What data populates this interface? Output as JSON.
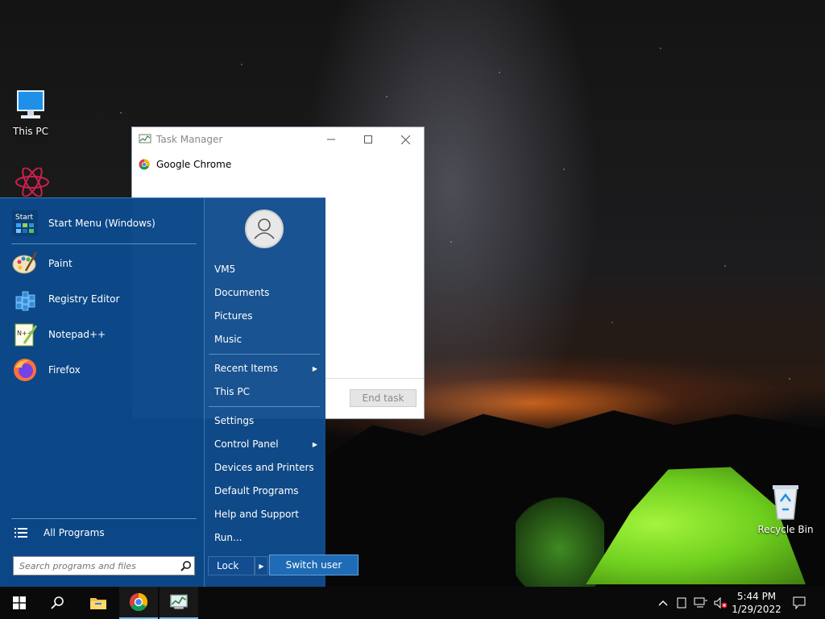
{
  "desktop": {
    "icons": {
      "this_pc": "This PC",
      "recycle_bin": "Recycle Bin"
    }
  },
  "task_manager": {
    "title": "Task Manager",
    "apps": [
      "Google Chrome"
    ],
    "end_task_label": "End task"
  },
  "start_menu": {
    "pinned": {
      "start_menu_app": "Start Menu (Windows)",
      "paint": "Paint",
      "registry_editor": "Registry Editor",
      "notepadpp": "Notepad++",
      "firefox": "Firefox"
    },
    "all_programs": "All Programs",
    "search_placeholder": "Search programs and files",
    "right": {
      "user": "VM5",
      "documents": "Documents",
      "pictures": "Pictures",
      "music": "Music",
      "recent_items": "Recent Items",
      "this_pc": "This PC",
      "settings": "Settings",
      "control_panel": "Control Panel",
      "devices_printers": "Devices and Printers",
      "default_programs": "Default Programs",
      "help_support": "Help and Support",
      "run": "Run..."
    },
    "lock_label": "Lock",
    "switch_user_label": "Switch user"
  },
  "taskbar": {
    "time": "5:44 PM",
    "date": "1/29/2022"
  },
  "colors": {
    "start_menu_bg": "#104c8c",
    "accent": "#1f6bb5",
    "taskbar_bg": "#0a0a0a"
  }
}
